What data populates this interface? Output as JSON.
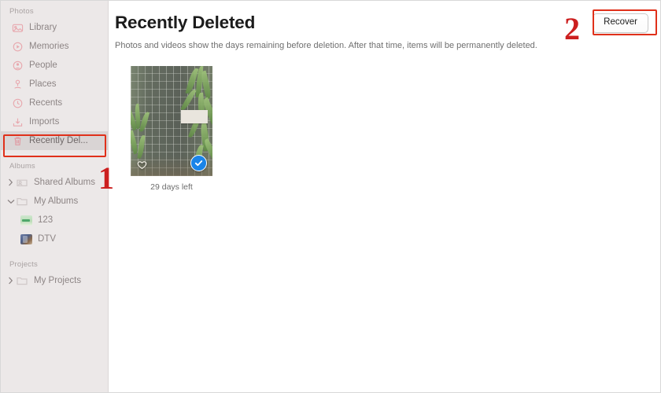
{
  "sidebar": {
    "sections": [
      {
        "title": "Photos",
        "items": [
          {
            "label": "Library",
            "icon": "library-icon",
            "selected": false
          },
          {
            "label": "Memories",
            "icon": "memories-icon",
            "selected": false
          },
          {
            "label": "People",
            "icon": "people-icon",
            "selected": false
          },
          {
            "label": "Places",
            "icon": "places-pin-icon",
            "selected": false
          },
          {
            "label": "Recents",
            "icon": "recents-clock-icon",
            "selected": false
          },
          {
            "label": "Imports",
            "icon": "imports-icon",
            "selected": false
          },
          {
            "label": "Recently Del...",
            "icon": "trash-icon",
            "selected": true
          }
        ]
      },
      {
        "title": "Albums",
        "items": [
          {
            "label": "Shared Albums",
            "icon": "shared-folder-icon",
            "chevron": "collapsed"
          },
          {
            "label": "My Albums",
            "icon": "folder-icon",
            "chevron": "expanded"
          },
          {
            "label": "123",
            "icon": "album-thumb-123",
            "chevron": "none"
          },
          {
            "label": "DTV",
            "icon": "album-thumb-dtv",
            "chevron": "none"
          }
        ]
      },
      {
        "title": "Projects",
        "items": [
          {
            "label": "My Projects",
            "icon": "folder-icon",
            "chevron": "collapsed"
          }
        ]
      }
    ]
  },
  "content": {
    "title": "Recently Deleted",
    "subtitle": "Photos and videos show the days remaining before deletion. After that time, items will be permanently deleted.",
    "recover_label": "Recover",
    "photos": [
      {
        "caption": "29 days left",
        "selected": true,
        "favorite": false,
        "favorite_icon": "heart-outline-icon",
        "selected_icon": "check-circle-icon"
      }
    ]
  },
  "annotations": [
    {
      "number": "1",
      "target": "sidebar-item-recently-deleted"
    },
    {
      "number": "2",
      "target": "recover-button"
    }
  ],
  "colors": {
    "sidebar_bg": "#ece8e8",
    "sidebar_icon": "#e8a8ae",
    "selection_blue": "#1a84e8",
    "annotation_red": "#e0301a",
    "annotation_number_red": "#cc1f1f"
  }
}
